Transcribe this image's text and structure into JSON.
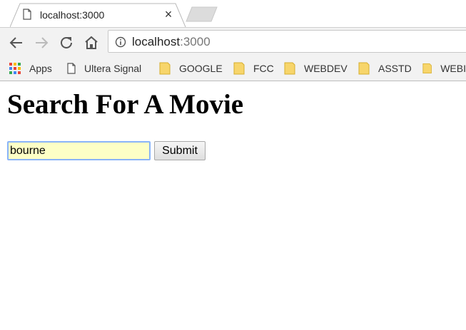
{
  "browser": {
    "tab": {
      "title": "localhost:3000",
      "close_label": "×"
    },
    "address_bar": {
      "host": "localhost",
      "port": ":3000"
    },
    "bookmarks": [
      {
        "label": "Apps",
        "icon": "apps-grid-icon"
      },
      {
        "label": "Ultera Signal",
        "icon": "page-icon"
      },
      {
        "label": "GOOGLE",
        "icon": "folder-icon"
      },
      {
        "label": "FCC",
        "icon": "folder-icon"
      },
      {
        "label": "WEBDEV",
        "icon": "folder-icon"
      },
      {
        "label": "ASSTD",
        "icon": "folder-icon"
      },
      {
        "label": "WEBI",
        "icon": "folder-icon"
      }
    ]
  },
  "page": {
    "title": "Search For A Movie",
    "search": {
      "value": "bourne"
    },
    "submit_label": "Submit"
  },
  "colors": {
    "folder": "#f7d56b",
    "input_autofill": "#fdffc6",
    "focus_ring": "#8ab4f8"
  }
}
